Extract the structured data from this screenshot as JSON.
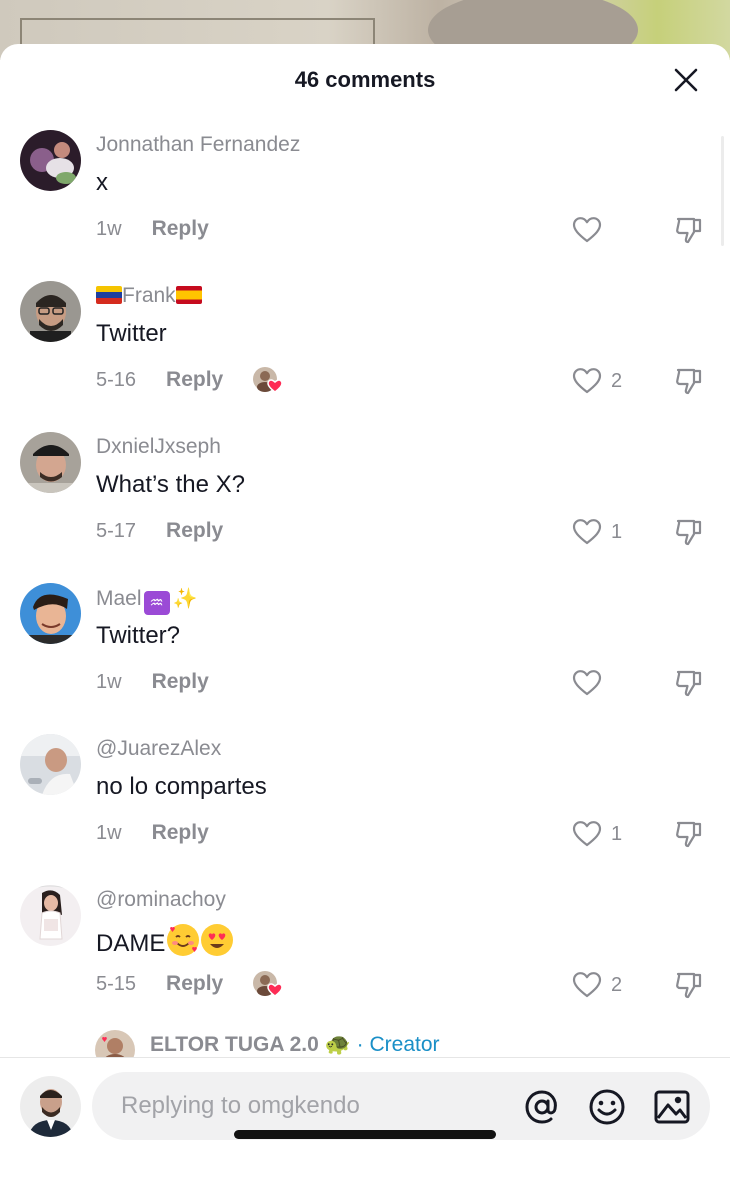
{
  "header": {
    "title": "46 comments",
    "close_icon": "close-icon"
  },
  "comments": [
    {
      "username": "Jonnathan Fernandez",
      "text": "x",
      "time": "1w",
      "reply": "Reply",
      "likes": ""
    },
    {
      "username_flag_left": "Venezuela",
      "username": "Frank",
      "username_flag_right": "Spain",
      "text": "Twitter",
      "time": "5-16",
      "reply": "Reply",
      "likes": "2",
      "creator_liked": true
    },
    {
      "username": "DxnielJxseph",
      "text": "What’s the X?",
      "time": "5-17",
      "reply": "Reply",
      "likes": "1"
    },
    {
      "username": "Mael",
      "username_emoji": [
        "aquarius",
        "sparkles"
      ],
      "text": "Twitter?",
      "time": "1w",
      "reply": "Reply",
      "likes": ""
    },
    {
      "username": "@JuarezAlex",
      "text": "no lo compartes",
      "time": "1w",
      "reply": "Reply",
      "likes": "1"
    },
    {
      "username": "@rominachoy",
      "text": "DAME",
      "text_emoji": [
        "smiling-face-with-hearts",
        "heart-eyes"
      ],
      "time": "5-15",
      "reply": "Reply",
      "likes": "2",
      "creator_liked": true
    }
  ],
  "creator_reply_preview": {
    "name": "ELTOR TUGA 2.0",
    "emoji": "turtle",
    "separator": "·",
    "tag": "Creator"
  },
  "composer": {
    "placeholder": "Replying to omgkendo",
    "icons": [
      "at-icon",
      "emoji-icon",
      "image-icon"
    ]
  },
  "colors": {
    "text": "#161823",
    "secondary": "#8a8b91",
    "creator": "#1a8fc7",
    "input_bg": "#f1f1f2",
    "heart": "#fe2c55"
  }
}
